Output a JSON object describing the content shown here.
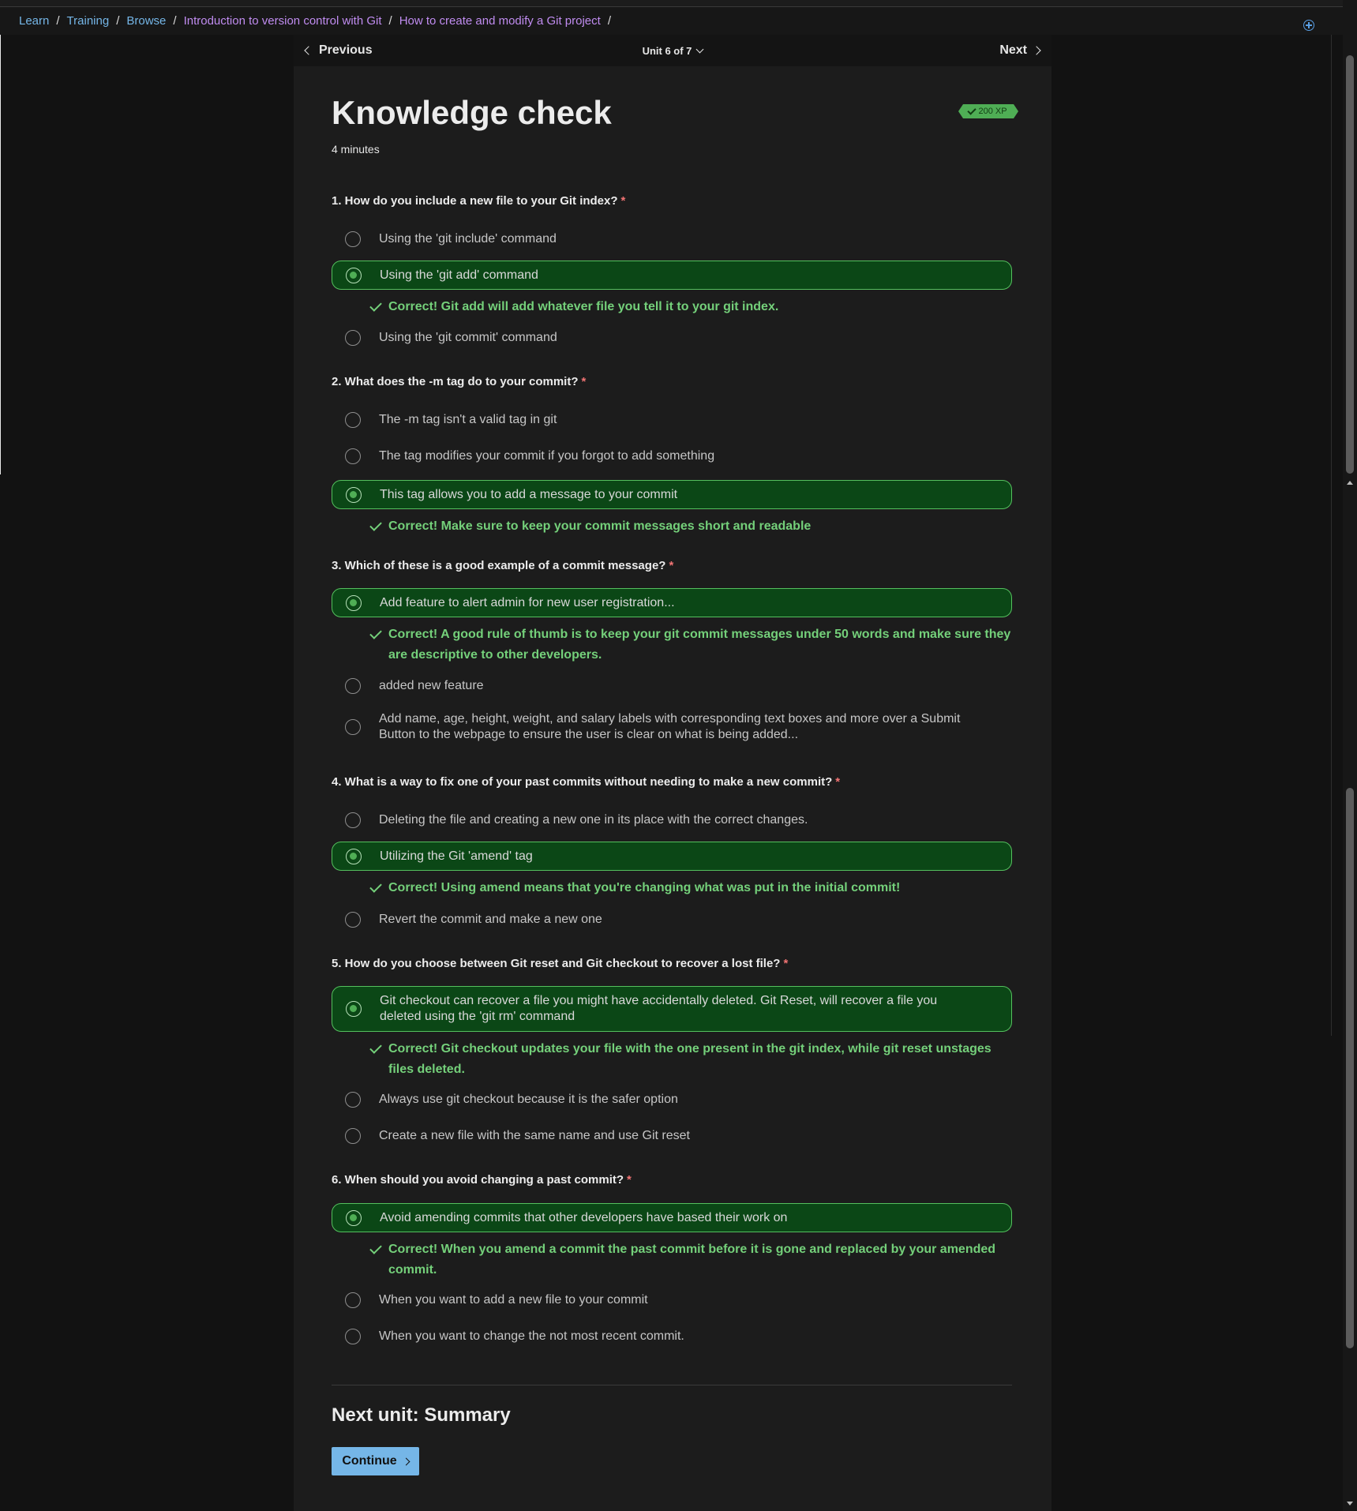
{
  "breadcrumb": {
    "items": [
      "Learn",
      "Training",
      "Browse",
      "Introduction to version control with Git",
      "How to create and modify a Git project"
    ],
    "separator": "/"
  },
  "unit_nav": {
    "previous_label": "Previous",
    "unit_indicator": "Unit 6 of 7",
    "next_label": "Next"
  },
  "page": {
    "title": "Knowledge check",
    "duration": "4 minutes",
    "xp_badge": "200 XP"
  },
  "questions": [
    {
      "text": "1. How do you include a new file to your Git index?",
      "required_mark": "*",
      "options": [
        "Using the 'git include' command",
        "Using the 'git add' command",
        "Using the 'git commit' command"
      ],
      "selected_index": 1,
      "feedback": "Correct! Git add will add whatever file you tell it to your git index."
    },
    {
      "text": "2. What does the -m tag do to your commit?",
      "required_mark": "*",
      "options": [
        "The -m tag isn't a valid tag in git",
        "The tag modifies your commit if you forgot to add something",
        "This tag allows you to add a message to your commit"
      ],
      "selected_index": 2,
      "feedback": "Correct! Make sure to keep your commit messages short and readable"
    },
    {
      "text": "3. Which of these is a good example of a commit message?",
      "required_mark": "*",
      "options": [
        "Add feature to alert admin for new user registration...",
        "added new feature",
        "Add name, age, height, weight, and salary labels with corresponding text boxes and more over a Submit Button to the webpage to ensure the user is clear on what is being added..."
      ],
      "selected_index": 0,
      "feedback": "Correct! A good rule of thumb is to keep your git commit messages under 50 words and make sure they are descriptive to other developers."
    },
    {
      "text": "4. What is a way to fix one of your past commits without needing to make a new commit?",
      "required_mark": "*",
      "options": [
        "Deleting the file and creating a new one in its place with the correct changes.",
        "Utilizing the Git 'amend' tag",
        "Revert the commit and make a new one"
      ],
      "selected_index": 1,
      "feedback": "Correct! Using amend means that you're changing what was put in the initial commit!"
    },
    {
      "text": "5. How do you choose between Git reset and Git checkout to recover a lost file?",
      "required_mark": "*",
      "options": [
        "Git checkout can recover a file you might have accidentally deleted. Git Reset, will recover a file you deleted using the 'git rm' command",
        "Always use git checkout because it is the safer option",
        "Create a new file with the same name and use Git reset"
      ],
      "selected_index": 0,
      "feedback": "Correct! Git checkout updates your file with the one present in the git index, while git reset unstages files deleted."
    },
    {
      "text": "6. When should you avoid changing a past commit?",
      "required_mark": "*",
      "options": [
        "Avoid amending commits that other developers have based their work on",
        "When you want to add a new file to your commit",
        "When you want to change the not most recent commit."
      ],
      "selected_index": 0,
      "feedback": "Correct! When you amend a commit the past commit before it is gone and replaced by your amended commit."
    }
  ],
  "next_unit": {
    "title": "Next unit: Summary",
    "continue_label": "Continue"
  },
  "colors": {
    "accent": "#75b6e7",
    "visited_link": "#c08cf0",
    "correct_bg": "#0b4716",
    "correct_border": "#54c05e",
    "correct_text": "#74d07a",
    "required": "#f27474"
  },
  "icons": [
    "chevron-left-icon",
    "chevron-down-icon",
    "chevron-right-icon",
    "check-icon",
    "radio-icon",
    "add-circle-icon"
  ]
}
